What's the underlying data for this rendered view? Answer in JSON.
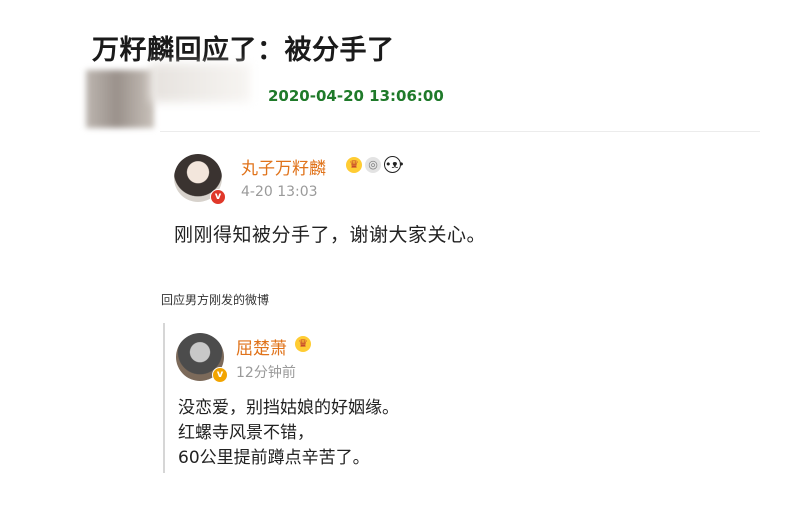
{
  "article": {
    "headline": "万籽麟回应了：被分手了",
    "timestamp": "2020-04-20 13:06:00"
  },
  "post": {
    "username": "丸子万籽麟",
    "badge": "v",
    "time": "4-20 13:03",
    "text": "刚刚得知被分手了，谢谢大家关心。",
    "emojis": [
      "crown-icon",
      "medal-icon",
      "panda-icon"
    ]
  },
  "caption": "回应男方刚发的微博",
  "reply": {
    "username": "屈楚萧",
    "badge": "v",
    "time": "12分钟前",
    "lines": [
      "没恋爱，别挡姑娘的好姻缘。",
      "红螺寺风景不错，",
      "60公里提前蹲点辛苦了。"
    ],
    "emojis": [
      "crown-icon"
    ]
  },
  "colors": {
    "username": "#e0731b",
    "timestamp": "#1f7a2a",
    "badge_orange": "#f2a400",
    "badge_red": "#e0382a"
  }
}
